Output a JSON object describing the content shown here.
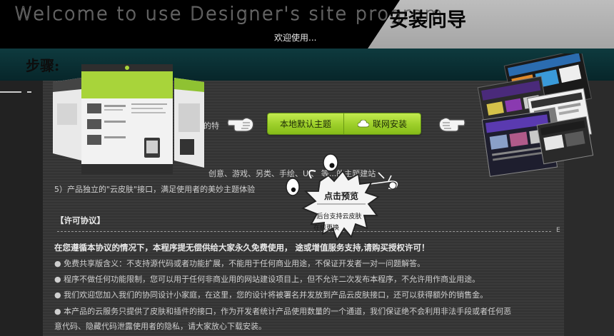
{
  "header": {
    "title_en": "Welcome to use Designer's site program",
    "title_cn": "安装向导",
    "subtitle": "欢迎使用..."
  },
  "steps_label": "步骤:",
  "buttons": {
    "local_theme": "本地默认主题",
    "online_install": "联网安装"
  },
  "preview_badge": {
    "title": "点击预览",
    "line1": "后台支持云皮肤",
    "line2": "在线更换"
  },
  "intro": {
    "line_partial_1": "的特",
    "line_partial_2": "创意、游戏、另类、手绘、UI、     等...的主题建站",
    "line_5": "5）产品独立的\"云皮肤\"接口，满足使用者的美妙主题体验"
  },
  "license": {
    "heading": "【许可协议】",
    "lead": "在您遵循本协议的情况下，本程序提无偿供给大家永久免费使用，                        途或增值服务支持,请购买授权许可！",
    "items": [
      "●  免费共享版含义：不支持源代码或者功能扩展，不能用于任何商业用途，不保证开发者一对一问题解答。",
      "●  程序不做任何功能限制，您可以用于任何非商业用的网站建设项目上，但不允许二次发布本程序，不允许用作商业用途。",
      "●  我们欢迎您加入我们的协同设计小家庭，在这里，您的设计将被署名并发放到产品云皮肤接口，还可以获得额外的销售金。",
      "●  本产品的云服务只提供了皮肤和插件的接口，作为开发者统计产品使用数量的一个通道，我们保证绝不会利用非法手段或者任何恶",
      "意代码、隐藏代码泄露使用者的隐私，请大家放心下载安装。"
    ]
  },
  "side_letter": "E",
  "colors": {
    "button_green": "#9fd12c",
    "teal_band": "#0e3a3e",
    "header_black": "#000000"
  }
}
